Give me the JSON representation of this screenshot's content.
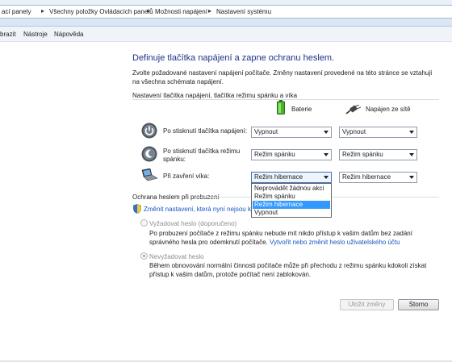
{
  "breadcrumbs": [
    "ací panely",
    "Všechny položky Ovládacích panelů",
    "Možnosti napájení",
    "Nastavení systému"
  ],
  "menubar": {
    "items": [
      "brazit",
      "Nástroje",
      "Nápověda"
    ]
  },
  "page": {
    "title": "Definuje tlačítka napájení a zapne ochranu heslem.",
    "description": "Zvolte požadované nastavení napájení počítače. Změny nastavení provedené na této stránce se vztahují na všechna schémata napájení."
  },
  "buttons_section": {
    "label": "Nastavení tlačítka napájení, tlačítka režimu spánku a víka",
    "columns": {
      "battery": "Baterie",
      "plugged": "Napájen ze sítě"
    },
    "rows": [
      {
        "label": "Po stisknutí tlačítka napájení:",
        "battery": "Vypnout",
        "plugged": "Vypnout"
      },
      {
        "label": "Po stisknutí tlačítka režimu spánku:",
        "battery": "Režim spánku",
        "plugged": "Režim spánku"
      },
      {
        "label": "Při zavření víka:",
        "battery": "Režim hibernace",
        "plugged": "Režim hibernace"
      }
    ],
    "dropdown_options": [
      "Neprovádět žádnou akci",
      "Režim spánku",
      "Režim hibernace",
      "Vypnout"
    ],
    "dropdown_selected": "Režim hibernace"
  },
  "password_section": {
    "label": "Ochrana heslem při probuzení",
    "change_link": "Změnit nastavení, která nyní nejsou k dis",
    "require": {
      "title": "Vyžadovat heslo (doporučeno)",
      "desc": "Po probuzení počítače z režimu spánku nebude mít nikdo přístup k vašim datům bez zadání správného hesla pro odemknutí počítače.",
      "link": "Vytvořit nebo změnit heslo uživatelského účtu"
    },
    "no_require": {
      "title": "Nevyžadovat heslo",
      "desc": "Během obnovování normální činnosti počítače může při přechodu z režimu spánku kdokoli získat přístup k vašim datům, protože počítač není zablokován."
    },
    "selected": "no_require"
  },
  "footer": {
    "save": "Uložit změny",
    "cancel": "Storno"
  },
  "colors": {
    "title": "#1e3287",
    "link": "#1a56c2",
    "selection": "#3399ff"
  },
  "icons": [
    "power-icon",
    "sleep-icon",
    "laptop-lid-icon",
    "battery-icon",
    "plug-icon",
    "shield-icon"
  ]
}
